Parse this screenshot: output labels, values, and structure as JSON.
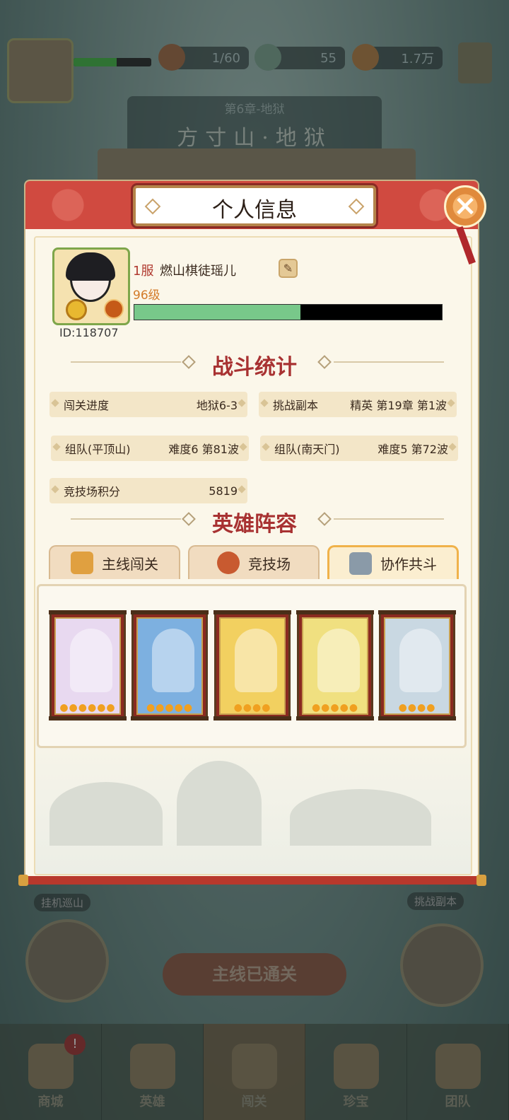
{
  "background": {
    "resources": [
      {
        "name": "stamina",
        "value": "1/60"
      },
      {
        "name": "gems",
        "value": "55"
      },
      {
        "name": "gold",
        "value": "1.7万"
      }
    ],
    "chapter_sub": "第6章-地狱",
    "chapter_title": "方寸山·地狱",
    "side_left_label": "挂机巡山",
    "side_right_label": "挑战副本",
    "main_cta": "主线已通关",
    "nav": [
      "商城",
      "英雄",
      "闯关",
      "珍宝",
      "团队"
    ]
  },
  "dialog": {
    "title": "个人信息",
    "close_icon": "×"
  },
  "profile": {
    "server": "1服",
    "name": "燃山棋徒瑶儿",
    "level": "96级",
    "id": "ID:118707",
    "exp_fraction": 0.54
  },
  "battle_stats": {
    "title": "战斗统计",
    "items": [
      {
        "label": "闯关进度",
        "value": "地狱6-3"
      },
      {
        "label": "挑战副本",
        "value": "精英 第19章 第1波"
      },
      {
        "label": "组队(平顶山)",
        "value": "难度6 第81波"
      },
      {
        "label": "组队(南天门)",
        "value": "难度5 第72波"
      },
      {
        "label": "竞技场积分",
        "value": "5819"
      }
    ]
  },
  "lineup": {
    "title": "英雄阵容",
    "tabs": [
      {
        "label": "主线闯关",
        "icon": "sword-icon"
      },
      {
        "label": "竞技场",
        "icon": "arena-icon"
      },
      {
        "label": "协作共斗",
        "icon": "coop-icon"
      }
    ],
    "active_tab": 2,
    "heroes": [
      {
        "name": "hero-1",
        "stars": 6,
        "color": "#e8d9f0"
      },
      {
        "name": "hero-2",
        "stars": 5,
        "color": "#7db0e0"
      },
      {
        "name": "hero-3",
        "stars": 4,
        "color": "#f2d060"
      },
      {
        "name": "hero-4",
        "stars": 5,
        "color": "#f0e080"
      },
      {
        "name": "hero-5",
        "stars": 4,
        "color": "#c9d8e2"
      }
    ]
  },
  "colors": {
    "accent_red": "#a83232",
    "header_red": "#d04a40",
    "exp_green": "#78c88a"
  }
}
